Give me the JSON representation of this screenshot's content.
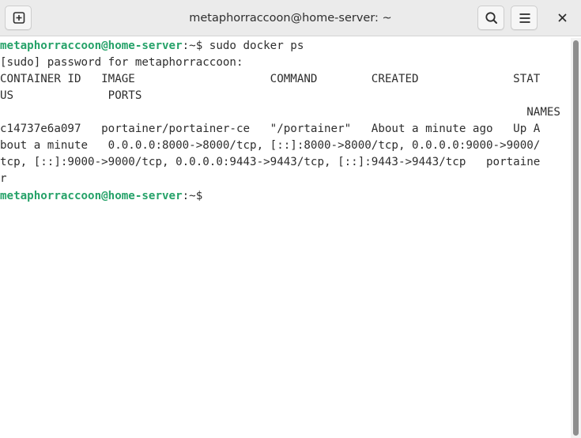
{
  "window": {
    "title": "metaphorraccoon@home-server: ~"
  },
  "toolbar": {
    "new_tab_icon": "new-tab-icon",
    "search_icon": "search-icon",
    "menu_icon": "hamburger-menu-icon",
    "close_icon": "close-icon"
  },
  "colors": {
    "prompt_user": "#26a269",
    "text": "#2e2e2e",
    "background": "#ffffff",
    "titlebar": "#ebebeb"
  },
  "terminal": {
    "prompt1": {
      "user_host": "metaphorraccoon@home-server",
      "path": ":~$ ",
      "command": "sudo docker ps"
    },
    "output": [
      "[sudo] password for metaphorraccoon:",
      "CONTAINER ID   IMAGE                    COMMAND        CREATED              STAT",
      "US              PORTS",
      "                                                                              NAMES",
      "c14737e6a097   portainer/portainer-ce   \"/portainer\"   About a minute ago   Up A",
      "bout a minute   0.0.0.0:8000->8000/tcp, [::]:8000->8000/tcp, 0.0.0.0:9000->9000/",
      "tcp, [::]:9000->9000/tcp, 0.0.0.0:9443->9443/tcp, [::]:9443->9443/tcp   portaine",
      "r"
    ],
    "prompt2": {
      "user_host": "metaphorraccoon@home-server",
      "path": ":~$",
      "command": ""
    }
  }
}
